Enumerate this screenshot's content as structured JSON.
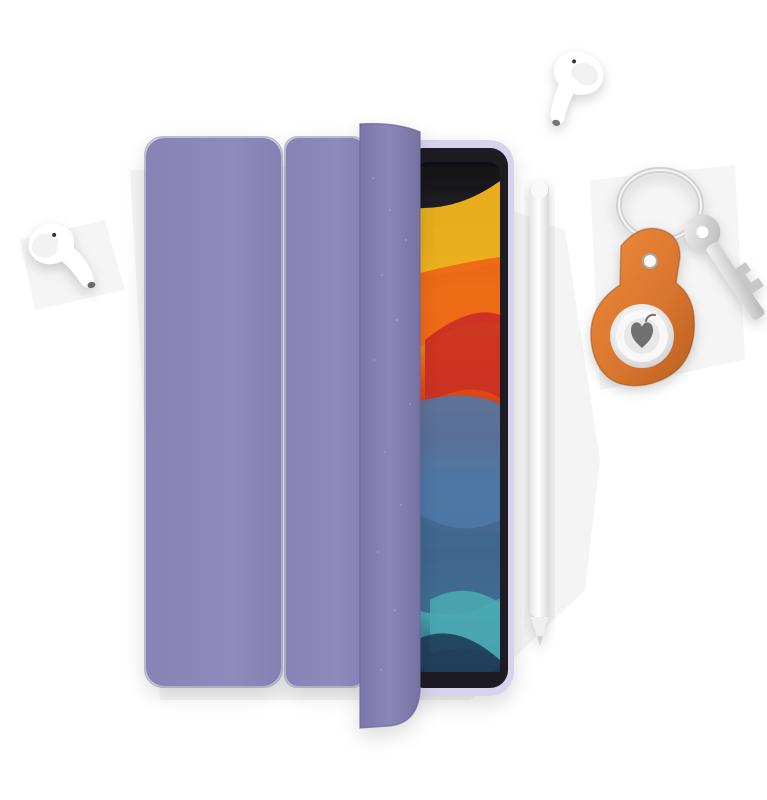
{
  "scene": {
    "items": [
      {
        "name": "airpod-left",
        "icon": "airpod-icon"
      },
      {
        "name": "airpod-right",
        "icon": "airpod-icon"
      },
      {
        "name": "ipad-mini",
        "icon": "tablet-icon"
      },
      {
        "name": "smart-folio",
        "icon": "folio-cover-icon"
      },
      {
        "name": "apple-pencil",
        "icon": "pencil-icon"
      },
      {
        "name": "airtag-keyring",
        "icon": "airtag-icon"
      }
    ],
    "colors": {
      "folio": "#8b86b8",
      "folio_dark": "#7a75a7",
      "folio_light": "#9f9bc7",
      "leather": "#d9772f",
      "leather_dark": "#b85f21",
      "screen_yellow": "#f2b51d",
      "screen_orange": "#ee6818",
      "screen_red": "#bf2b22",
      "screen_blue": "#4d7aa6",
      "screen_teal": "#4aa9b3",
      "device_frame": "#1b1a24",
      "device_body": "#d8d3ec",
      "pencil": "#f7f7f7",
      "airpod": "#ffffff",
      "key_metal": "#d8d8d8"
    }
  }
}
